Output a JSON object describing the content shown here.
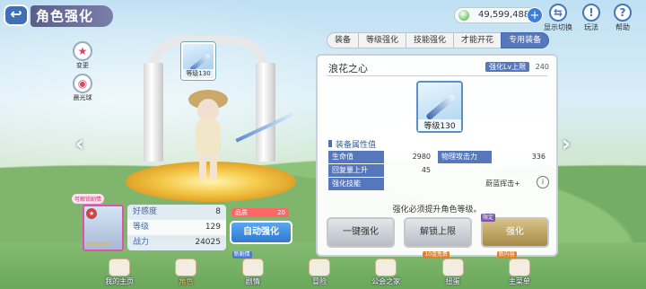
{
  "header": {
    "title": "角色强化",
    "back_icon": "back-arrow-icon",
    "jewels": "49,599,488",
    "jewel_plus": "+",
    "icons": [
      {
        "name": "display-toggle",
        "label": "显示切换",
        "glyph": "⇆"
      },
      {
        "name": "gameplay",
        "label": "玩法",
        "glyph": "!"
      },
      {
        "name": "help",
        "label": "帮助",
        "glyph": "?"
      }
    ]
  },
  "side": {
    "transform_label": "变更",
    "starlight_label": "晨光球"
  },
  "preview": {
    "equip_level": "等级130",
    "love_badge": "可解锁剧情"
  },
  "character": {
    "stats": [
      {
        "label": "好感度",
        "value": "8"
      },
      {
        "label": "等级",
        "value": "129"
      },
      {
        "label": "战力",
        "value": "24025"
      }
    ],
    "quality_label": "品质",
    "quality_value": "20",
    "auto_button": "自动强化"
  },
  "tabs": [
    {
      "label": "装备",
      "active": false
    },
    {
      "label": "等级强化",
      "active": false
    },
    {
      "label": "技能强化",
      "active": false
    },
    {
      "label": "才能开花",
      "active": false
    },
    {
      "label": "专用装备",
      "active": true
    }
  ],
  "equipment": {
    "name": "浪花之心",
    "limit_label": "强化Lv上限",
    "limit_value": "240",
    "level": "等级130",
    "attr_title": "装备属性值",
    "attrs": {
      "hp_label": "生命值",
      "hp_value": "2980",
      "atk_label": "物理攻击力",
      "atk_value": "336",
      "heal_label": "回复量上升",
      "heal_value": "45",
      "skill_label": "强化技能",
      "skill_value": "蔚蓝挥击+"
    },
    "notice": "强化必须提升角色等级。",
    "buttons": {
      "one_click": "一键强化",
      "unlock_limit": "解锁上限",
      "enhance": "强化",
      "enhance_tag": "限定"
    }
  },
  "bottom_nav": [
    {
      "label": "我的主页",
      "active": false
    },
    {
      "label": "角色",
      "active": true
    },
    {
      "label": "剧情",
      "active": false
    },
    {
      "label": "冒险",
      "active": false
    },
    {
      "label": "公会之家",
      "active": false
    },
    {
      "label": "扭蛋",
      "active": false
    },
    {
      "label": "主菜单",
      "active": false
    }
  ],
  "nav_badges": {
    "story_new": "新剧情",
    "gacha": "10连免费",
    "menu_new": "新内容"
  }
}
